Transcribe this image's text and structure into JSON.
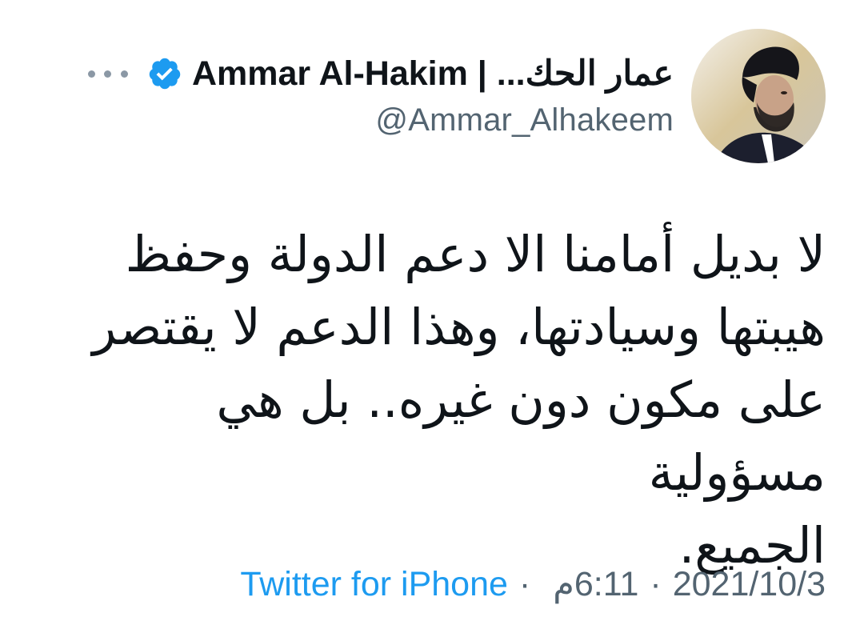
{
  "tweet": {
    "author": {
      "display_name": "عمار الحك... | Ammar Al-Hakim",
      "handle": "@Ammar_Alhakeem",
      "verified": true
    },
    "body": "لا بديل أمامنا الا دعم الدولة وحفظ\nهيبتها وسيادتها، وهذا الدعم لا يقتصر\nعلى مكون دون غيره.. بل هي مسؤولية\nالجميع.",
    "meta": {
      "date": "2021/10/3",
      "separator": "·",
      "time": "6:11",
      "ampm": "م",
      "source": "Twitter for iPhone"
    }
  },
  "icons": {
    "verified": "verified-badge-icon",
    "more": "more-horizontal-icon"
  },
  "colors": {
    "accent": "#1d9bf0",
    "text": "#0f1419",
    "secondary": "#536471"
  }
}
